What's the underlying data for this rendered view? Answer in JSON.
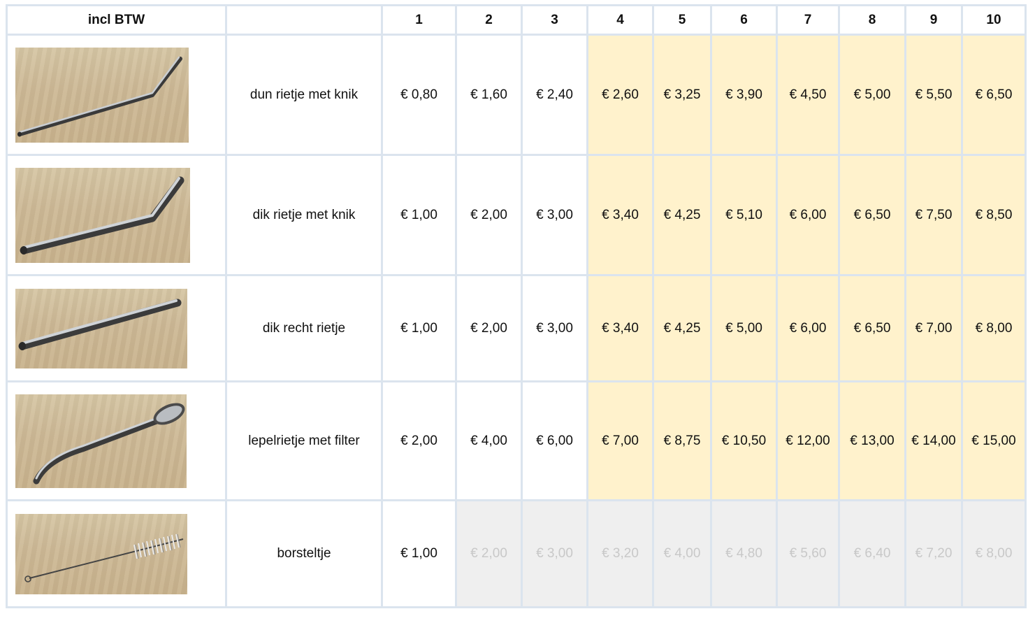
{
  "header": {
    "corner_label": "incl BTW",
    "name_header": "",
    "quantities": [
      "1",
      "2",
      "3",
      "4",
      "5",
      "6",
      "7",
      "8",
      "9",
      "10"
    ]
  },
  "products": [
    {
      "name": "dun rietje met knik",
      "prices": [
        "€ 0,80",
        "€ 1,60",
        "€ 2,40",
        "€ 2,60",
        "€ 3,25",
        "€ 3,90",
        "€ 4,50",
        "€ 5,00",
        "€ 5,50",
        "€ 6,50"
      ]
    },
    {
      "name": "dik rietje met knik",
      "prices": [
        "€ 1,00",
        "€ 2,00",
        "€ 3,00",
        "€ 3,40",
        "€ 4,25",
        "€ 5,10",
        "€ 6,00",
        "€ 6,50",
        "€ 7,50",
        "€ 8,50"
      ]
    },
    {
      "name": "dik recht rietje",
      "prices": [
        "€ 1,00",
        "€ 2,00",
        "€ 3,00",
        "€ 3,40",
        "€ 4,25",
        "€ 5,00",
        "€ 6,00",
        "€ 6,50",
        "€ 7,00",
        "€ 8,00"
      ]
    },
    {
      "name": "lepelrietje met filter",
      "prices": [
        "€ 2,00",
        "€ 4,00",
        "€ 6,00",
        "€ 7,00",
        "€ 8,75",
        "€ 10,50",
        "€ 12,00",
        "€ 13,00",
        "€ 14,00",
        "€ 15,00"
      ]
    },
    {
      "name": "borsteltje",
      "prices": [
        "€ 1,00",
        "€ 2,00",
        "€ 3,00",
        "€ 3,20",
        "€ 4,00",
        "€ 4,80",
        "€ 5,60",
        "€ 6,40",
        "€ 7,20",
        "€ 8,00"
      ]
    }
  ],
  "colors": {
    "grid_border": "#dbe4ee",
    "discount_tier_background": "#fff2cc",
    "unavailable_background": "#efefef",
    "unavailable_text": "#c8c8c8"
  },
  "icons": [
    "bent-thin-straw-photo",
    "bent-thick-straw-photo",
    "straight-thick-straw-photo",
    "spoon-straw-photo",
    "cleaning-brush-photo"
  ]
}
